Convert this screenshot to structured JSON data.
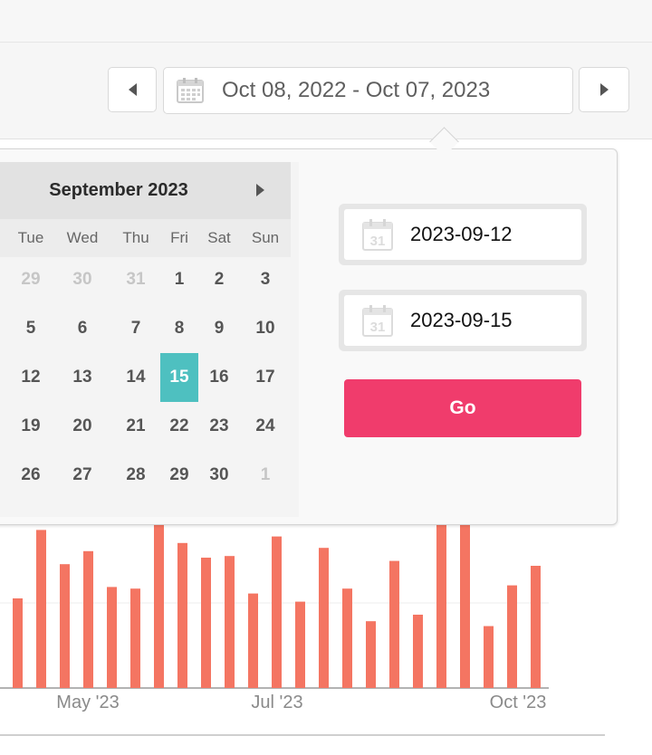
{
  "toolbar": {
    "prev_icon": "caret-left-icon",
    "next_icon": "caret-right-icon",
    "calendar_icon": "calendar-icon",
    "range_label": "Oct 08, 2022 - Oct 07, 2023"
  },
  "calendar": {
    "month_label": "September 2023",
    "next_icon": "caret-right-icon",
    "weekdays": [
      "Tue",
      "Wed",
      "Thu",
      "Fri",
      "Sat",
      "Sun"
    ],
    "weeks": [
      [
        "29",
        "30",
        "31",
        "1",
        "2",
        "3"
      ],
      [
        "5",
        "6",
        "7",
        "8",
        "9",
        "10"
      ],
      [
        "12",
        "13",
        "14",
        "15",
        "16",
        "17"
      ],
      [
        "19",
        "20",
        "21",
        "22",
        "23",
        "24"
      ],
      [
        "26",
        "27",
        "28",
        "29",
        "30",
        "1"
      ]
    ],
    "muted": [
      [
        0,
        0
      ],
      [
        0,
        1
      ],
      [
        0,
        2
      ],
      [
        4,
        5
      ]
    ],
    "selected": [
      2,
      3
    ],
    "selected_color": "#4ec0c0"
  },
  "fields": {
    "start_value": "2023-09-12",
    "end_value": "2023-09-15",
    "field_icon": "calendar-31-icon"
  },
  "go": {
    "label": "Go",
    "color": "#f03c6c"
  },
  "chart_data": {
    "type": "bar",
    "bar_color": "#f47562",
    "x_ticks": [
      "May '23",
      "Jul '23",
      "Oct '23"
    ],
    "values": [
      0.55,
      0.97,
      0.76,
      0.84,
      0.62,
      0.61,
      1.0,
      0.89,
      0.8,
      0.81,
      0.58,
      0.93,
      0.53,
      0.86,
      0.61,
      0.41,
      0.78,
      0.45,
      1.0,
      1.0,
      0.38,
      0.63,
      0.75
    ]
  }
}
